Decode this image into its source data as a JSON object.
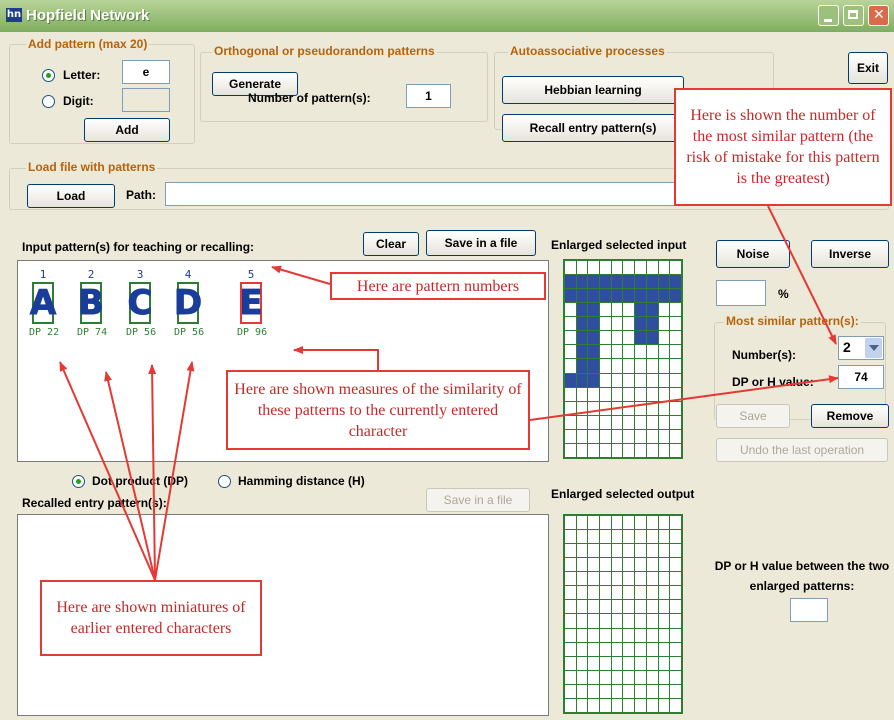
{
  "window": {
    "title": "Hopfield Network",
    "icon": "hn"
  },
  "add_pattern": {
    "group_label": "Add pattern (max 20)",
    "letter_label": "Letter:",
    "letter_value": "e",
    "digit_label": "Digit:",
    "digit_value": "",
    "selected": "letter",
    "add_button": "Add"
  },
  "ortho": {
    "group_label": "Orthogonal or pseudorandom patterns",
    "generate_button": "Generate",
    "count_label": "Number of pattern(s):",
    "count_value": "1"
  },
  "auto": {
    "group_label": "Autoassociative processes",
    "hebbian_button": "Hebbian learning",
    "recall_button": "Recall entry pattern(s)",
    "icon": "syringe-icon"
  },
  "exit_button": "Exit",
  "load": {
    "group_label": "Load file with patterns",
    "load_button": "Load",
    "path_label": "Path:",
    "path_value": ""
  },
  "input_panel": {
    "label": "Input pattern(s) for teaching or recalling:",
    "clear_button": "Clear",
    "save_button": "Save in a file",
    "patterns": [
      {
        "number": "1",
        "letter": "A",
        "measure": "DP  22",
        "selected": false
      },
      {
        "number": "2",
        "letter": "B",
        "measure": "DP  74",
        "selected": false
      },
      {
        "number": "3",
        "letter": "C",
        "measure": "DP  56",
        "selected": false
      },
      {
        "number": "4",
        "letter": "D",
        "measure": "DP  56",
        "selected": false
      },
      {
        "number": "5",
        "letter": "E",
        "measure": "DP  96",
        "selected": true
      }
    ]
  },
  "enlarged_input": {
    "label": "Enlarged selected input",
    "cols": 10,
    "rows": 14,
    "filled": [
      "1,1",
      "1,2",
      "1,3",
      "1,4",
      "1,5",
      "1,6",
      "1,7",
      "1,8",
      "2,1",
      "2,2",
      "2,3",
      "2,4",
      "2,5",
      "2,6",
      "2,7",
      "2,8",
      "1,9",
      "1,10",
      "1,11",
      "1,12",
      "2,9",
      "2,10",
      "2,11",
      "2,12",
      "3,1",
      "4,1",
      "5,1",
      "6,1",
      "7,1",
      "8,1",
      "3,2",
      "4,2",
      "5,2",
      "6,2",
      "7,2",
      "8,2",
      "3,6",
      "4,6",
      "5,6",
      "3,7",
      "4,7",
      "5,7",
      "3,11",
      "4,11",
      "5,11",
      "6,11",
      "7,11",
      "8,11",
      "3,12",
      "4,12",
      "5,12",
      "6,12",
      "7,12",
      "8,12",
      "1,0",
      "2,0",
      "8,0"
    ]
  },
  "enlarged_output": {
    "label": "Enlarged selected output",
    "cols": 10,
    "rows": 14,
    "filled": []
  },
  "noise_button": "Noise",
  "inverse_button": "Inverse",
  "noise_percent_value": "",
  "noise_percent_unit": "%",
  "most_similar": {
    "group_label": "Most similar pattern(s):",
    "number_label": "Number(s):",
    "number_value": "2",
    "dp_label": "DP or H value:",
    "dp_value": "74"
  },
  "save_button": "Save",
  "remove_button": "Remove",
  "undo_button": "Undo the last operation",
  "measure_mode": {
    "dp_label": "Dot product (DP)",
    "h_label": "Hamming distance (H)",
    "selected": "dp"
  },
  "recalled": {
    "label": "Recalled entry pattern(s):",
    "save_button": "Save in a file"
  },
  "between": {
    "label": "DP or H value between the two enlarged patterns:",
    "value": ""
  },
  "annotations": {
    "most_similar": "Here is shown the number of the most similar pattern (the risk of mistake for this pattern is the greatest)",
    "numbers": "Here are pattern numbers",
    "measures": "Here are shown measures of the similarity of these patterns to the currently entered character",
    "miniatures": "Here are shown miniatures of earlier entered characters"
  },
  "colors": {
    "accent": "#e53935",
    "pattern_blue": "#2f4ea0",
    "grid_green": "#2e7d32",
    "group_label": "#b8620a"
  }
}
